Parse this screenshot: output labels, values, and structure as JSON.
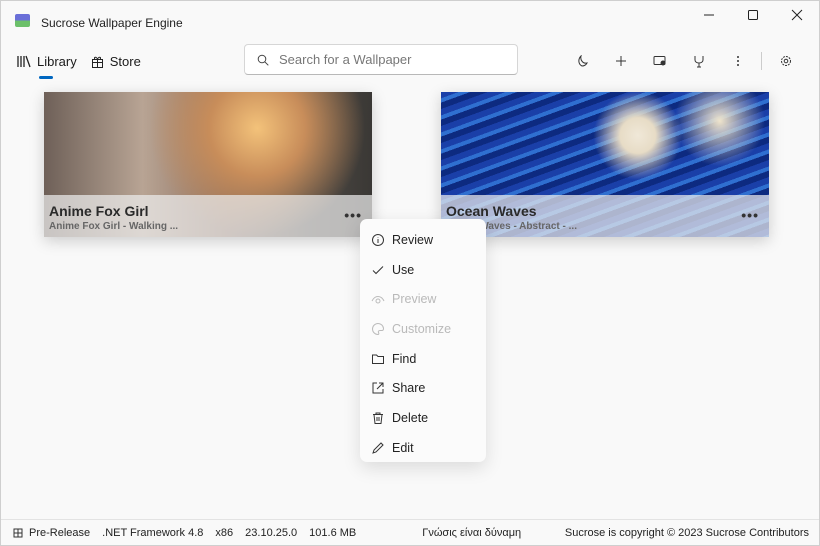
{
  "window": {
    "title": "Sucrose Wallpaper Engine"
  },
  "nav": {
    "items": [
      {
        "label": "Library",
        "icon": "library-icon",
        "selected": true
      },
      {
        "label": "Store",
        "icon": "store-icon"
      }
    ]
  },
  "search": {
    "placeholder": "Search for a Wallpaper",
    "value": ""
  },
  "toolbar": {
    "icons": [
      "theme-icon",
      "add-icon",
      "display-icon",
      "cleanup-icon",
      "more-icon",
      "settings-icon"
    ]
  },
  "cards": [
    {
      "title": "Anime Fox Girl",
      "subtitle": "Anime Fox Girl - Walking ..."
    },
    {
      "title": "Ocean Waves",
      "subtitle": "Ocean Waves - Abstract - ..."
    }
  ],
  "context_menu": {
    "items": [
      {
        "label": "Review",
        "icon": "info-icon",
        "enabled": true
      },
      {
        "label": "Use",
        "icon": "check-icon",
        "enabled": true
      },
      {
        "label": "Preview",
        "icon": "eye-icon",
        "enabled": false
      },
      {
        "label": "Customize",
        "icon": "palette-icon",
        "enabled": false
      },
      {
        "label": "Find",
        "icon": "folder-icon",
        "enabled": true
      },
      {
        "label": "Share",
        "icon": "share-icon",
        "enabled": true
      },
      {
        "label": "Delete",
        "icon": "delete-icon",
        "enabled": true
      },
      {
        "label": "Edit",
        "icon": "edit-icon",
        "enabled": true
      }
    ]
  },
  "status": {
    "channel": "Pre-Release",
    "framework": ".NET Framework 4.8",
    "arch": "x86",
    "version": "23.10.25.0",
    "memory": "101.6 MB",
    "motto": "Γνώσις είναι δύναμη",
    "copyright": "Sucrose is copyright © 2023 Sucrose Contributors"
  },
  "colors": {
    "accent": "#0067c0"
  }
}
